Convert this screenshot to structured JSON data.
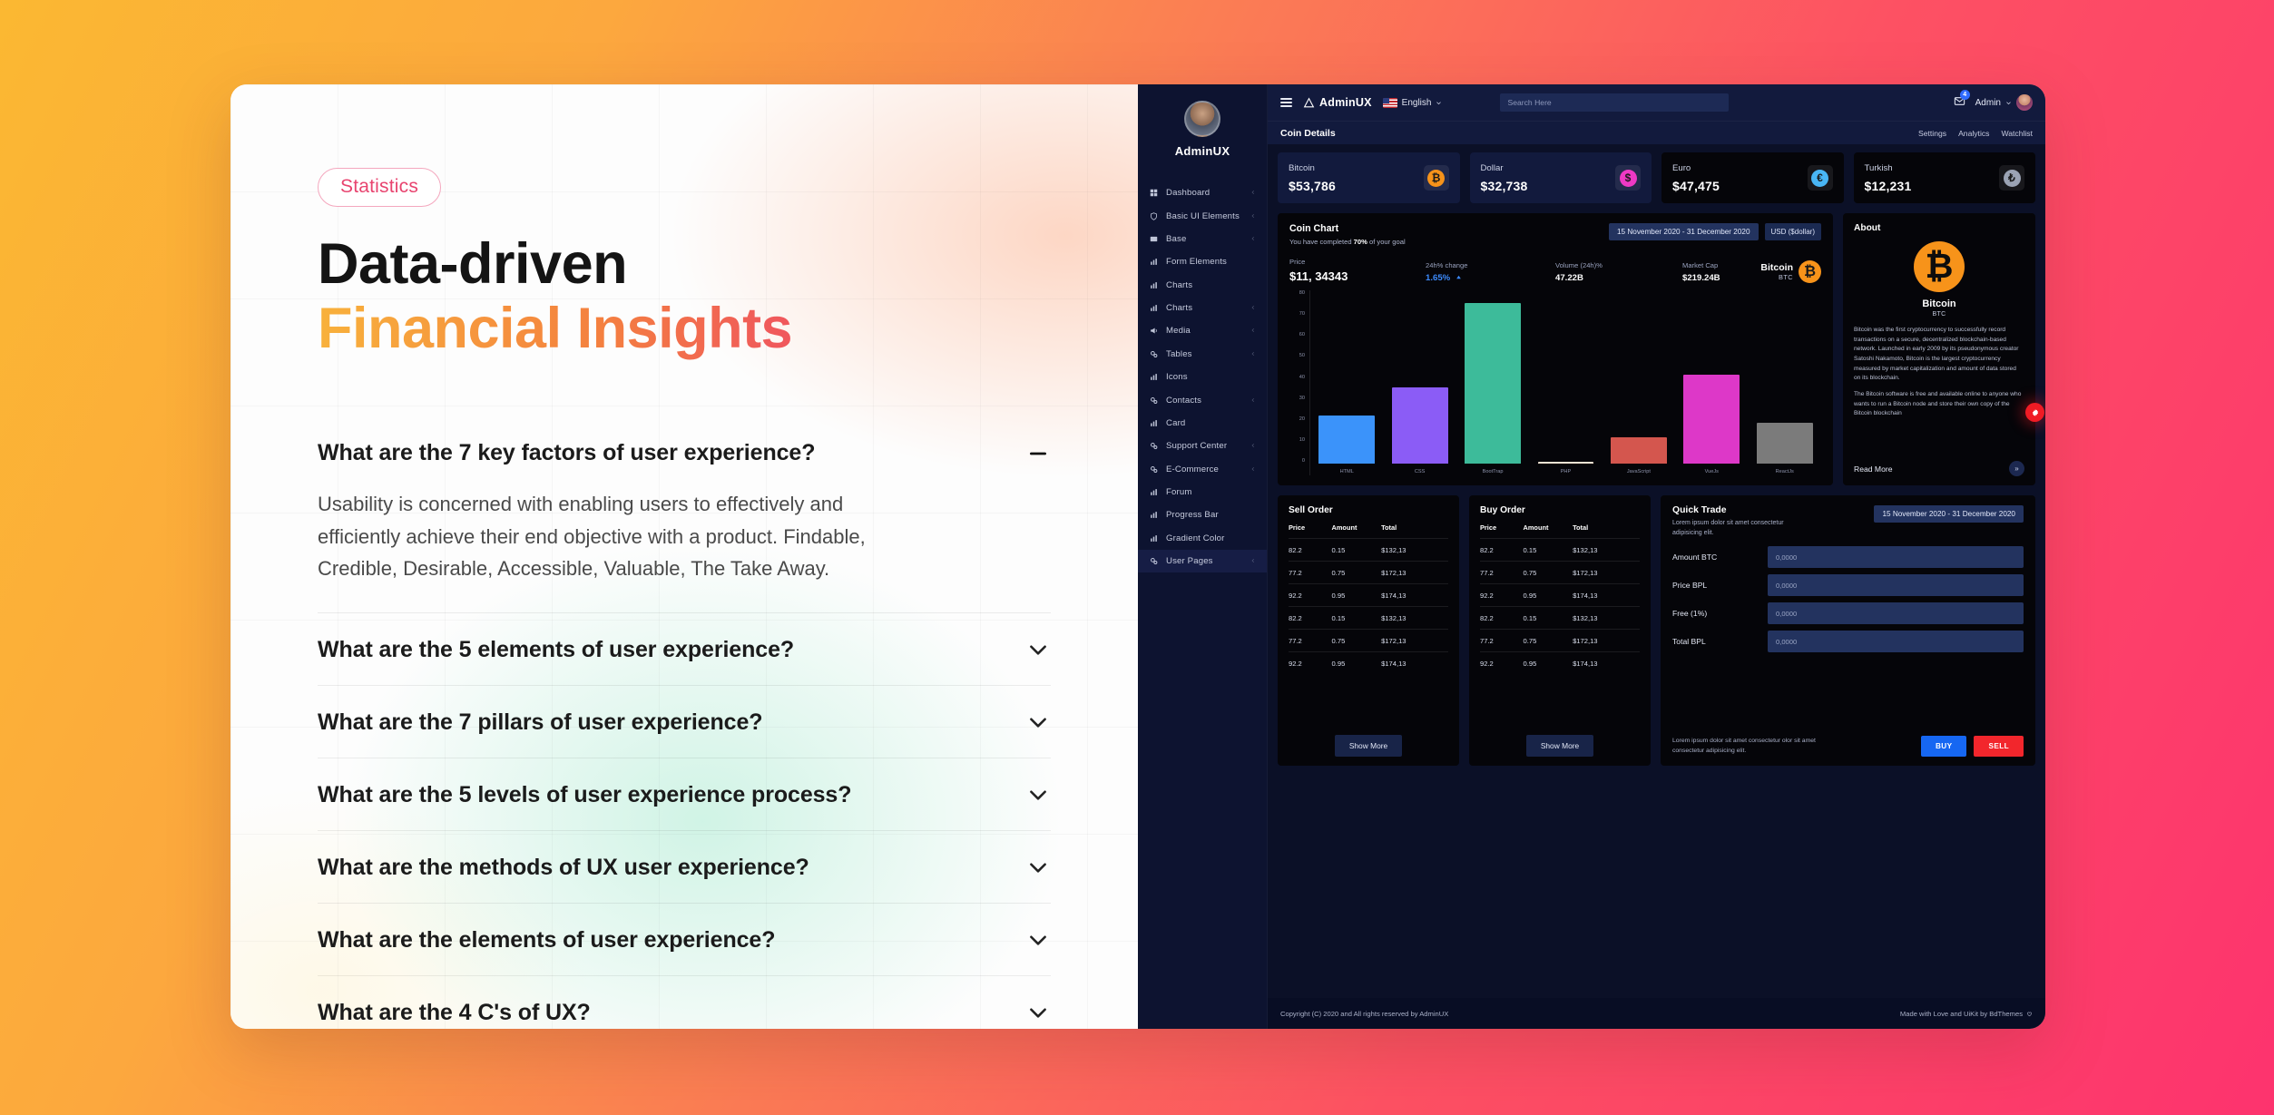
{
  "left": {
    "badge": "Statistics",
    "title_line1": "Data-driven",
    "title_line2": "Financial Insights",
    "faq": [
      {
        "q": "What are the 7 key factors of user experience?",
        "a": "Usability is concerned with enabling users to effectively and efficiently achieve their end objective with a product. Findable, Credible, Desirable, Accessible, Valuable, The Take Away.",
        "open": true
      },
      {
        "q": "What are the 5 elements of user experience?",
        "a": "",
        "open": false
      },
      {
        "q": "What are the 7 pillars of user experience?",
        "a": "",
        "open": false
      },
      {
        "q": "What are the 5 levels of user experience process?",
        "a": "",
        "open": false
      },
      {
        "q": "What are the methods of UX user experience?",
        "a": "",
        "open": false
      },
      {
        "q": "What are the elements of user experience?",
        "a": "",
        "open": false
      },
      {
        "q": "What are the 4 C's of UX?",
        "a": "",
        "open": false
      }
    ]
  },
  "dashboard": {
    "sidebar": {
      "brand": "AdminUX",
      "items": [
        {
          "label": "Dashboard",
          "icon": "dashboard-icon",
          "caret": true
        },
        {
          "label": "Basic UI Elements",
          "icon": "shield-icon",
          "caret": true
        },
        {
          "label": "Base",
          "icon": "mail-icon",
          "caret": true
        },
        {
          "label": "Form Elements",
          "icon": "chart-icon",
          "caret": false
        },
        {
          "label": "Charts",
          "icon": "chart-icon",
          "caret": false
        },
        {
          "label": "Charts",
          "icon": "chart-icon",
          "caret": true
        },
        {
          "label": "Media",
          "icon": "megaphone-icon",
          "caret": true
        },
        {
          "label": "Tables",
          "icon": "gear-icon",
          "caret": true
        },
        {
          "label": "Icons",
          "icon": "chart-icon",
          "caret": false
        },
        {
          "label": "Contacts",
          "icon": "gear-icon",
          "caret": true
        },
        {
          "label": "Card",
          "icon": "chart-icon",
          "caret": false
        },
        {
          "label": "Support Center",
          "icon": "gear-icon",
          "caret": true
        },
        {
          "label": "E-Commerce",
          "icon": "gear-icon",
          "caret": true
        },
        {
          "label": "Forum",
          "icon": "chart-icon",
          "caret": false
        },
        {
          "label": "Progress Bar",
          "icon": "chart-icon",
          "caret": false
        },
        {
          "label": "Gradient Color",
          "icon": "chart-icon",
          "caret": false
        },
        {
          "label": "User Pages",
          "icon": "gear-icon",
          "caret": true
        }
      ]
    },
    "topbar": {
      "logo_text": "AdminUX",
      "language": "English",
      "search_placeholder": "Search Here",
      "mail_badge": "4",
      "admin_label": "Admin"
    },
    "subbar": {
      "title": "Coin Details",
      "links": [
        "Settings",
        "Analytics",
        "Watchlist"
      ]
    },
    "stats": [
      {
        "name": "Bitcoin",
        "value": "$53,786",
        "symbol": "₿",
        "color": "#F7931A",
        "theme": "navy"
      },
      {
        "name": "Dollar",
        "value": "$32,738",
        "symbol": "$",
        "color": "#EE39C4",
        "theme": "navy"
      },
      {
        "name": "Euro",
        "value": "$47,475",
        "symbol": "€",
        "color": "#49B6F5",
        "theme": "black"
      },
      {
        "name": "Turkish",
        "value": "$12,231",
        "symbol": "₺",
        "color": "#9BA3B4",
        "theme": "black"
      }
    ],
    "coin_chart": {
      "title": "Coin Chart",
      "subtitle_pre": "You have completed ",
      "subtitle_bold": "70%",
      "subtitle_post": " of your goal",
      "date_range": "15 November 2020 - 31 December 2020",
      "currency": "USD ($dollar)",
      "metrics": [
        {
          "label": "Price",
          "value": "$11, 34343",
          "style": "big"
        },
        {
          "label": "24h% change",
          "value": "1.65%",
          "style": "blue"
        },
        {
          "label": "Volume (24h)%",
          "value": "47.22B",
          "style": "sm"
        },
        {
          "label": "Market Cap",
          "value": "$219.24B",
          "style": "sm"
        }
      ],
      "coin_name": "Bitcoin",
      "coin_symbol": "BTC",
      "coin_glyph": "₿"
    },
    "about": {
      "title": "About",
      "coin_name": "Bitcoin",
      "coin_symbol": "BTC",
      "coin_glyph": "₿",
      "paragraph1": "Bitcoin was the first cryptocurrency to successfully record transactions on a secure, decentralized blockchain-based network. Launched in early 2009 by its pseudonymous creator Satoshi Nakamoto, Bitcoin is the largest cryptocurrency measured by market capitalization and amount of data stored on its blockchain.",
      "paragraph2": "The Bitcoin software is free and available online to anyone who wants to run a Bitcoin node and store their own copy of the Bitcoin blockchain",
      "read_more": "Read More",
      "arrow": "»"
    },
    "orders": {
      "columns": [
        "Price",
        "Amount",
        "Total"
      ],
      "show_more": "Show More",
      "sell": {
        "title": "Sell Order",
        "rows": [
          [
            "82.2",
            "0.15",
            "$132,13"
          ],
          [
            "77.2",
            "0.75",
            "$172,13"
          ],
          [
            "92.2",
            "0.95",
            "$174,13"
          ],
          [
            "82.2",
            "0.15",
            "$132,13"
          ],
          [
            "77.2",
            "0.75",
            "$172,13"
          ],
          [
            "92.2",
            "0.95",
            "$174,13"
          ]
        ]
      },
      "buy": {
        "title": "Buy Order",
        "rows": [
          [
            "82.2",
            "0.15",
            "$132,13"
          ],
          [
            "77.2",
            "0.75",
            "$172,13"
          ],
          [
            "92.2",
            "0.95",
            "$174,13"
          ],
          [
            "82.2",
            "0.15",
            "$132,13"
          ],
          [
            "77.2",
            "0.75",
            "$172,13"
          ],
          [
            "92.2",
            "0.95",
            "$174,13"
          ]
        ]
      }
    },
    "quick_trade": {
      "title": "Quick Trade",
      "subtitle": "Lorem ipsum dolor sit amet consectetur adipisicing elit.",
      "date_range": "15 November 2020 - 31 December 2020",
      "fields": [
        {
          "label": "Amount BTC",
          "placeholder": "0,0000",
          "value": ""
        },
        {
          "label": "Price BPL",
          "placeholder": "0,0000",
          "value": ""
        },
        {
          "label": "Free (1%)",
          "placeholder": "0,0000",
          "value": ""
        },
        {
          "label": "Total BPL",
          "placeholder": "0,0000",
          "value": ""
        }
      ],
      "footer_note": "Lorem ipsum dolor sit amet consectetur olor sit amet consectetur adipisicing elit.",
      "buy_label": "BUY",
      "sell_label": "SELL"
    },
    "footer": {
      "left": "Copyright (C) 2020 and All rights reserved by AdminUX",
      "right": "Made with Love and UiKit by BdThemes"
    }
  },
  "chart_data": {
    "type": "bar",
    "title": "Coin Chart",
    "categories": [
      "HTML",
      "CSS",
      "BootTrap",
      "PHP",
      "JavaScript",
      "VueJs",
      "ReactJs"
    ],
    "values": [
      22,
      35,
      74,
      1,
      12,
      41,
      19
    ],
    "colors": [
      "#3B93FA",
      "#8B5CF6",
      "#3DBB9A",
      "#F3E3D3",
      "#D4564E",
      "#DD38C8",
      "#7B7B7B"
    ],
    "yticks": [
      "80",
      "70",
      "60",
      "50",
      "40",
      "30",
      "20",
      "10",
      "0"
    ],
    "ylim": [
      0,
      80
    ],
    "xlabel": "",
    "ylabel": "",
    "grid": false,
    "legend": false
  }
}
